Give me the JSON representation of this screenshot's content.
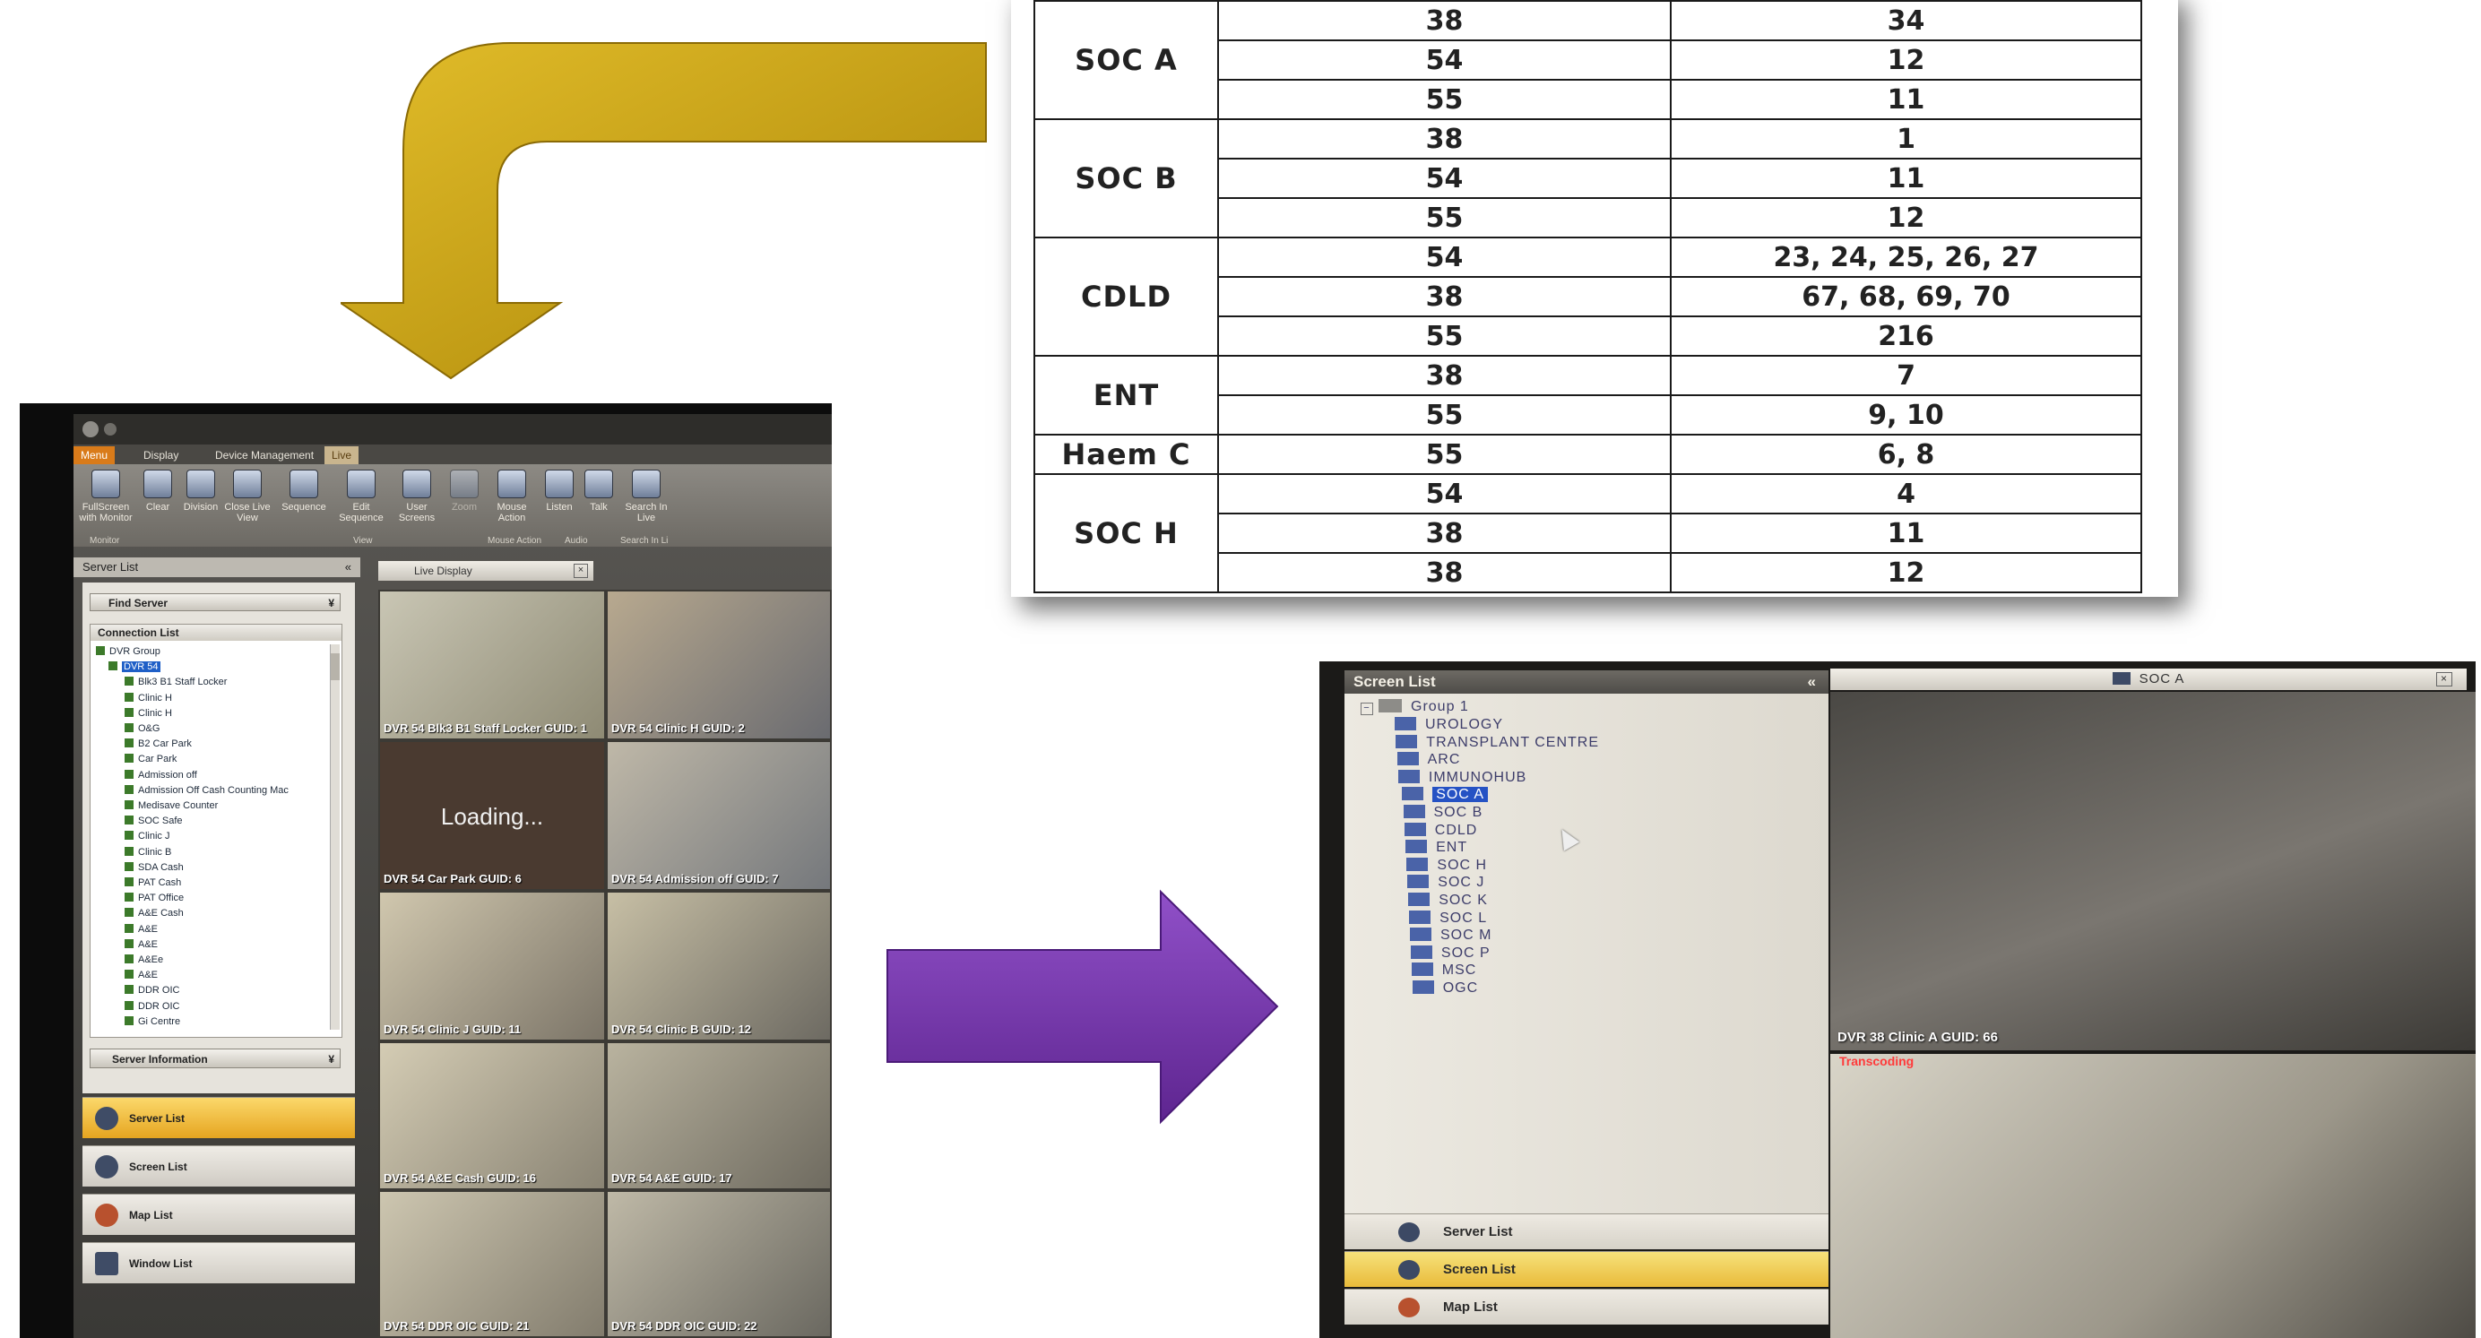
{
  "table": {
    "groups": [
      {
        "name": "SOC A",
        "rows": [
          [
            "38",
            "34"
          ],
          [
            "54",
            "12"
          ],
          [
            "55",
            "11"
          ]
        ]
      },
      {
        "name": "SOC B",
        "rows": [
          [
            "38",
            "1"
          ],
          [
            "54",
            "11"
          ],
          [
            "55",
            "12"
          ]
        ]
      },
      {
        "name": "CDLD",
        "rows": [
          [
            "54",
            "23, 24, 25, 26, 27"
          ],
          [
            "38",
            "67, 68, 69, 70"
          ],
          [
            "55",
            "216"
          ]
        ]
      },
      {
        "name": "ENT",
        "rows": [
          [
            "38",
            "7"
          ],
          [
            "55",
            "9, 10"
          ]
        ]
      },
      {
        "name": "Haem C",
        "rows": [
          [
            "55",
            "6, 8"
          ]
        ]
      },
      {
        "name": "SOC H",
        "rows": [
          [
            "54",
            "4"
          ],
          [
            "38",
            "11"
          ],
          [
            "38",
            "12"
          ]
        ]
      }
    ]
  },
  "arrows": {
    "gold": "#c8a012",
    "purple": "#7a38b0"
  },
  "left_app": {
    "tabs": [
      "Menu",
      "Display",
      "Device Management",
      "Live"
    ],
    "ribbon_buttons": [
      "FullScreen with Monitor",
      "Clear",
      "Division",
      "Close Live View",
      "Sequence",
      "Edit Sequence",
      "User Screens",
      "Zoom",
      "Mouse Action",
      "Listen",
      "Talk",
      "Search In Live"
    ],
    "ribbon_groups": [
      "Monitor",
      "View",
      "Mouse Action",
      "Audio",
      "Search In Li"
    ],
    "server_list_title": "Server List",
    "find_server": "Find Server",
    "connection_list": "Connection List",
    "tree": [
      "DVR Group",
      "DVR 54",
      "Blk3 B1 Staff Locker",
      "Clinic H",
      "Clinic H",
      "O&G",
      "B2 Car Park",
      "Car Park",
      "Admission off",
      "Admission Off Cash Counting Mac",
      "Medisave Counter",
      "SOC Safe",
      "Clinic J",
      "Clinic B",
      "SDA Cash",
      "PAT Cash",
      "PAT Office",
      "A&E Cash",
      "A&E",
      "A&E",
      "A&Ee",
      "A&E",
      "DDR OIC",
      "DDR OIC",
      "Gi Centre"
    ],
    "server_information": "Server Information",
    "nav": [
      "Server List",
      "Screen List",
      "Map List",
      "Window List"
    ],
    "live_display_tab": "Live Display",
    "loading_text": "Loading...",
    "cameras": [
      "DVR 54 Blk3 B1 Staff Locker GUID: 1",
      "DVR 54 Clinic H GUID: 2",
      "DVR 54 Car Park GUID: 6",
      "DVR 54 Admission off GUID: 7",
      "DVR 54 Clinic J GUID: 11",
      "DVR 54 Clinic B GUID: 12",
      "DVR 54 A&E Cash GUID: 16",
      "DVR 54 A&E GUID: 17",
      "DVR 54 DDR OIC GUID: 21",
      "DVR 54 DDR OIC GUID: 22"
    ]
  },
  "right_app": {
    "screen_list_title": "Screen List",
    "collapse_glyph": "«",
    "group": "Group 1",
    "items": [
      "UROLOGY",
      "TRANSPLANT CENTRE",
      "ARC",
      "IMMUNOHUB",
      "SOC A",
      "SOC B",
      "CDLD",
      "ENT",
      "SOC H",
      "SOC J",
      "SOC K",
      "SOC L",
      "SOC M",
      "SOC P",
      "MSC",
      "OGC"
    ],
    "selected_item": "SOC A",
    "nav": [
      "Server List",
      "Screen List",
      "Map List"
    ],
    "view_tab": "SOC A",
    "camera_caption": "DVR 38 Clinic A GUID: 66",
    "transcoding": "Transcoding"
  }
}
